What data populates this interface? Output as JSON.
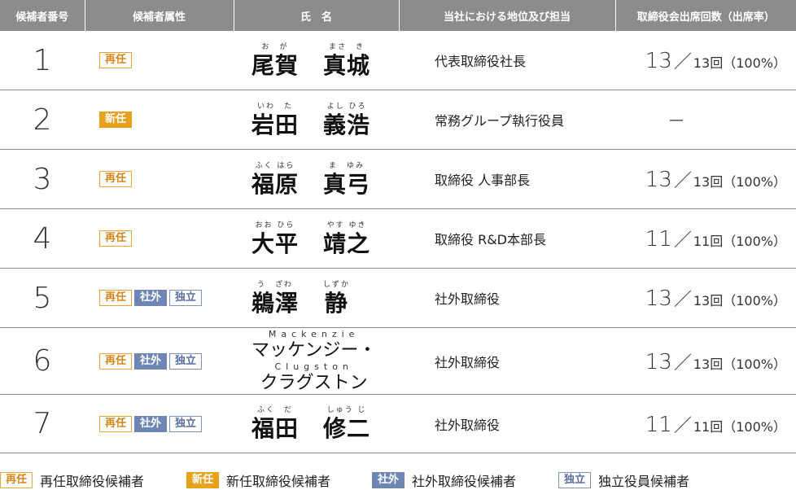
{
  "headers": [
    "候補者番号",
    "候補者属性",
    "氏　名",
    "当社における地位及び担当",
    "取締役会出席回数（出席率）"
  ],
  "rows": [
    {
      "no": "1",
      "badges": [
        "reappoint"
      ],
      "name": {
        "type": "jp",
        "parts": [
          {
            "ruby": "お　が",
            "kanji": "尾賀"
          },
          {
            "ruby": "まさ　き",
            "kanji": "真城"
          }
        ]
      },
      "position": "代表取締役社長",
      "attendance": {
        "attended": "13",
        "slash": "／",
        "total": "13回",
        "rate": "（100%）"
      }
    },
    {
      "no": "2",
      "badges": [
        "new"
      ],
      "name": {
        "type": "jp",
        "parts": [
          {
            "ruby": "いわ　た",
            "kanji": "岩田"
          },
          {
            "ruby": "よし ひろ",
            "kanji": "義浩"
          }
        ]
      },
      "position": "常務グループ執行役員",
      "attendance": {
        "dash": "—"
      }
    },
    {
      "no": "3",
      "badges": [
        "reappoint"
      ],
      "name": {
        "type": "jp",
        "parts": [
          {
            "ruby": "ふく はら",
            "kanji": "福原"
          },
          {
            "ruby": "ま　ゆみ",
            "kanji": "真弓"
          }
        ]
      },
      "position": "取締役 人事部長",
      "attendance": {
        "attended": "13",
        "slash": "／",
        "total": "13回",
        "rate": "（100%）"
      }
    },
    {
      "no": "4",
      "badges": [
        "reappoint"
      ],
      "name": {
        "type": "jp",
        "parts": [
          {
            "ruby": "おお ひら",
            "kanji": "大平"
          },
          {
            "ruby": "やす ゆき",
            "kanji": "靖之"
          }
        ]
      },
      "position": "取締役 R&D本部長",
      "attendance": {
        "attended": "11",
        "slash": "／",
        "total": "11回",
        "rate": "（100%）"
      }
    },
    {
      "no": "5",
      "badges": [
        "reappoint",
        "outside",
        "independent"
      ],
      "name": {
        "type": "jp",
        "parts": [
          {
            "ruby": "う　ざわ",
            "kanji": "鵜澤"
          },
          {
            "ruby": "しずか",
            "kanji": "静"
          }
        ]
      },
      "position": "社外取締役",
      "attendance": {
        "attended": "13",
        "slash": "／",
        "total": "13回",
        "rate": "（100%）"
      }
    },
    {
      "no": "6",
      "badges": [
        "reappoint",
        "outside",
        "independent"
      ],
      "name": {
        "type": "foreign",
        "ruby1": "Mackenzie",
        "kana1": "マッケンジー・",
        "ruby2": "Clugston",
        "kana2": "クラグストン"
      },
      "position": "社外取締役",
      "attendance": {
        "attended": "13",
        "slash": "／",
        "total": "13回",
        "rate": "（100%）"
      }
    },
    {
      "no": "7",
      "badges": [
        "reappoint",
        "outside",
        "independent"
      ],
      "name": {
        "type": "jp",
        "parts": [
          {
            "ruby": "ふく　だ",
            "kanji": "福田"
          },
          {
            "ruby": "しゅう じ",
            "kanji": "修二"
          }
        ]
      },
      "position": "社外取締役",
      "attendance": {
        "attended": "11",
        "slash": "／",
        "total": "11回",
        "rate": "（100%）"
      }
    }
  ],
  "badge_labels": {
    "reappoint": "再任",
    "new": "新任",
    "outside": "社外",
    "independent": "独立"
  },
  "legend": [
    {
      "badge": "reappoint",
      "text": "再任取締役候補者"
    },
    {
      "badge": "new",
      "text": "新任取締役候補者"
    },
    {
      "badge": "outside",
      "text": "社外取締役候補者"
    },
    {
      "badge": "independent",
      "text": "独立役員候補者"
    }
  ],
  "colors": {
    "header_bg": "#8c8c8c",
    "reappoint": "#e8a33a",
    "new": "#e8a11c",
    "outside": "#6f86b5",
    "independent": "#7d93c2"
  }
}
